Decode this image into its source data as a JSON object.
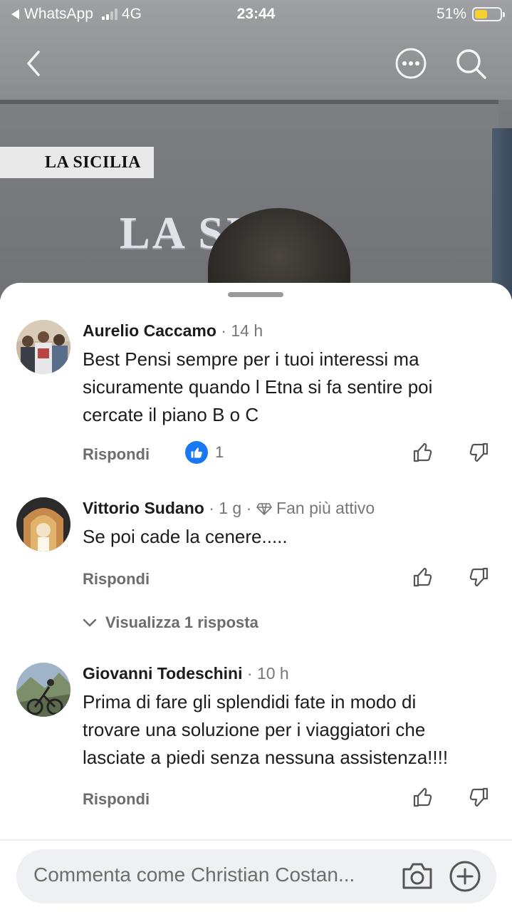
{
  "status_bar": {
    "back_app": "WhatsApp",
    "network": "4G",
    "time": "23:44",
    "battery": "51%",
    "battery_level": 0.51
  },
  "video": {
    "banner_text": "LA SICILIA",
    "wall_sign": "LA SI   IA"
  },
  "nav": {
    "back_icon": "chevron-left-icon",
    "more_icon": "more-options-icon",
    "search_icon": "search-icon"
  },
  "comments": [
    {
      "author": "Aurelio Caccamo",
      "meta": "· 14 h",
      "text_lines": [
        "Best Pensi sempre per i tuoi interessi ma",
        "sicuramente quando l  Etna si fa sentire poi",
        "cercate il piano B o C"
      ],
      "reply_label": "Rispondi",
      "like_count": "1"
    },
    {
      "author": "Vittorio Sudano",
      "meta": "· 1 g ·",
      "badge": "Fan più attivo",
      "text_lines": [
        "Se poi cade la cenere....."
      ],
      "reply_label": "Rispondi",
      "view_replies": "Visualizza 1 risposta"
    },
    {
      "author": "Giovanni Todeschini",
      "meta": "· 10 h",
      "text_lines": [
        "Prima di fare gli splendidi fate in modo di",
        "trovare una soluzione per i viaggiatori che",
        "lasciate a piedi senza nessuna assistenza!!!!"
      ],
      "reply_label": "Rispondi"
    }
  ],
  "composer": {
    "placeholder": "Commenta come Christian Costan..."
  },
  "colors": {
    "like_blue": "#1877f2",
    "muted_text": "#6d6d6d",
    "battery_yellow": "#f7d12e"
  }
}
